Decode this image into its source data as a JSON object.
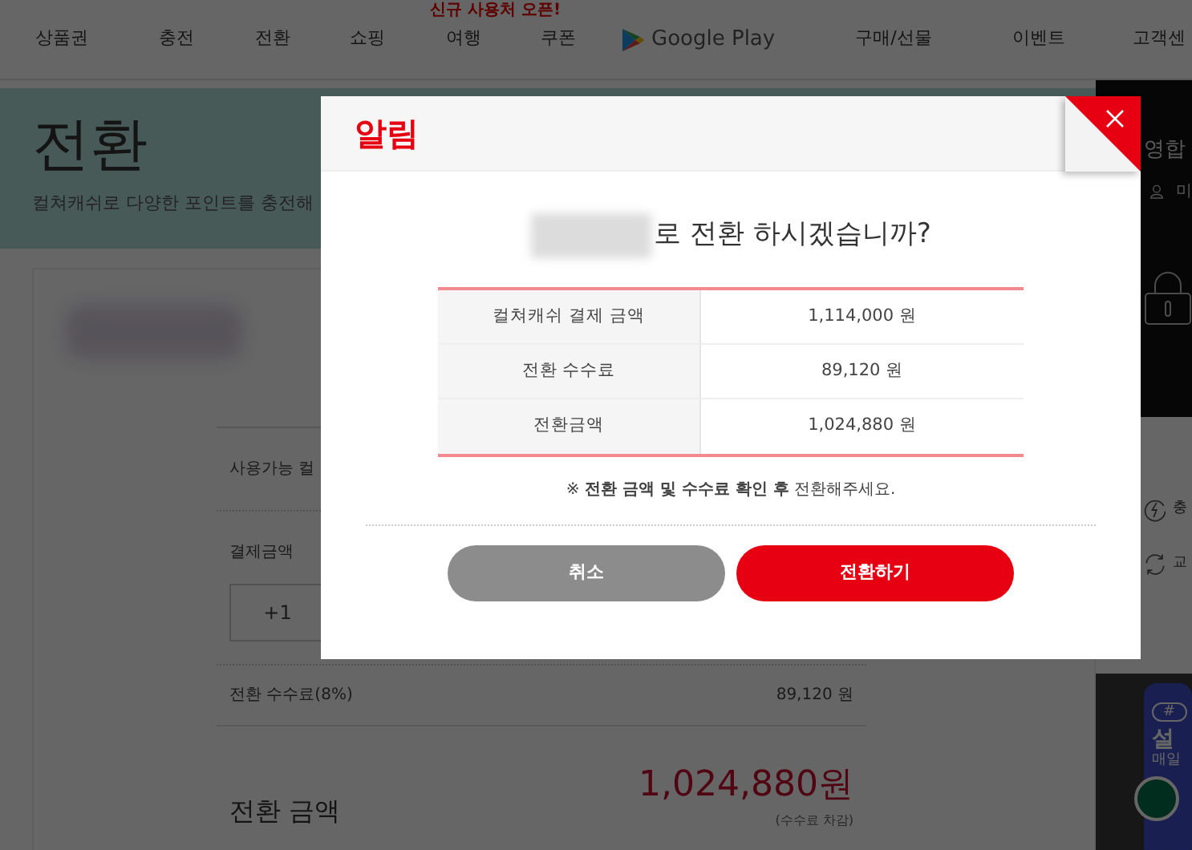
{
  "nav": {
    "badge": "신규 사용처 오픈!",
    "items": [
      {
        "label": "상품권",
        "kind": "text"
      },
      {
        "label": "충전",
        "kind": "text"
      },
      {
        "label": "전환",
        "kind": "text"
      },
      {
        "label": "쇼핑",
        "kind": "text"
      },
      {
        "label": "여행",
        "kind": "text",
        "badged": true
      },
      {
        "label": "쿠폰",
        "kind": "text"
      },
      {
        "label": "Google Play",
        "kind": "store"
      },
      {
        "label": "구매/선물",
        "kind": "text"
      },
      {
        "label": "이벤트",
        "kind": "text"
      },
      {
        "label": "고객센",
        "kind": "text"
      }
    ]
  },
  "hero": {
    "title": "전환",
    "subtitle": "컬쳐캐쉬로 다양한 포인트를 충전해"
  },
  "form": {
    "available_label": "사용가능 컬",
    "amount_label": "결제금액",
    "amount_button": "+1",
    "fee_label": "전환 수수료(8%)",
    "fee_value": "89,120 원",
    "total_label": "전환 금액",
    "total_value": "1,024,880원",
    "total_note": "(수수료 차감)"
  },
  "side_panel": {
    "title": "영합",
    "user_text": "미",
    "menu": [
      {
        "label": "충",
        "kind": "charge"
      },
      {
        "label": "교",
        "kind": "exchange"
      }
    ],
    "promo": {
      "tag": "#",
      "title": "설",
      "subtitle": "매일"
    }
  },
  "dialog": {
    "title": "알림",
    "message": "로 전환 하시겠습니까?",
    "rows": [
      {
        "label": "컬쳐캐쉬 결제 금액",
        "value": "1,114,000 원"
      },
      {
        "label": "전환 수수료",
        "value": "89,120 원"
      },
      {
        "label": "전환금액",
        "value": "1,024,880 원"
      }
    ],
    "note": "※ **전환 금액 및 수수료 확인 후** 전환해주세요.",
    "buttons": [
      {
        "label": "취소",
        "kind": "cancel"
      },
      {
        "label": "전환하기",
        "kind": "primary"
      }
    ]
  }
}
